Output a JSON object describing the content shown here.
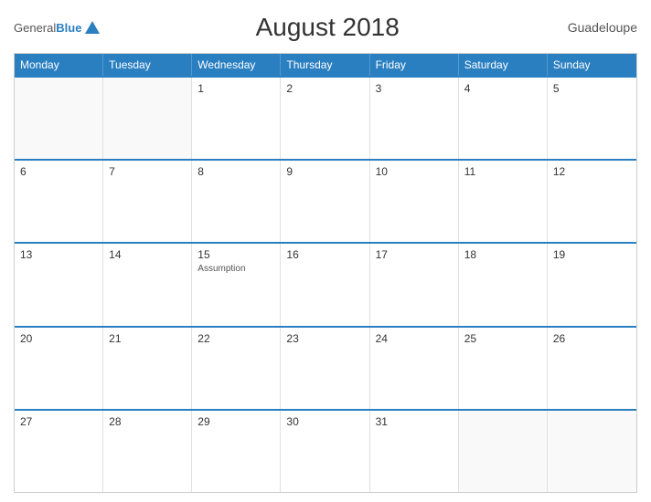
{
  "header": {
    "logo_general": "General",
    "logo_blue": "Blue",
    "title": "August 2018",
    "region": "Guadeloupe"
  },
  "weekdays": [
    "Monday",
    "Tuesday",
    "Wednesday",
    "Thursday",
    "Friday",
    "Saturday",
    "Sunday"
  ],
  "weeks": [
    [
      {
        "day": "",
        "empty": true
      },
      {
        "day": "",
        "empty": true
      },
      {
        "day": "1",
        "empty": false
      },
      {
        "day": "2",
        "empty": false
      },
      {
        "day": "3",
        "empty": false
      },
      {
        "day": "4",
        "empty": false
      },
      {
        "day": "5",
        "empty": false
      }
    ],
    [
      {
        "day": "6",
        "empty": false
      },
      {
        "day": "7",
        "empty": false
      },
      {
        "day": "8",
        "empty": false
      },
      {
        "day": "9",
        "empty": false
      },
      {
        "day": "10",
        "empty": false
      },
      {
        "day": "11",
        "empty": false
      },
      {
        "day": "12",
        "empty": false
      }
    ],
    [
      {
        "day": "13",
        "empty": false
      },
      {
        "day": "14",
        "empty": false
      },
      {
        "day": "15",
        "empty": false,
        "event": "Assumption"
      },
      {
        "day": "16",
        "empty": false
      },
      {
        "day": "17",
        "empty": false
      },
      {
        "day": "18",
        "empty": false
      },
      {
        "day": "19",
        "empty": false
      }
    ],
    [
      {
        "day": "20",
        "empty": false
      },
      {
        "day": "21",
        "empty": false
      },
      {
        "day": "22",
        "empty": false
      },
      {
        "day": "23",
        "empty": false
      },
      {
        "day": "24",
        "empty": false
      },
      {
        "day": "25",
        "empty": false
      },
      {
        "day": "26",
        "empty": false
      }
    ],
    [
      {
        "day": "27",
        "empty": false
      },
      {
        "day": "28",
        "empty": false
      },
      {
        "day": "29",
        "empty": false
      },
      {
        "day": "30",
        "empty": false
      },
      {
        "day": "31",
        "empty": false
      },
      {
        "day": "",
        "empty": true
      },
      {
        "day": "",
        "empty": true
      }
    ]
  ]
}
